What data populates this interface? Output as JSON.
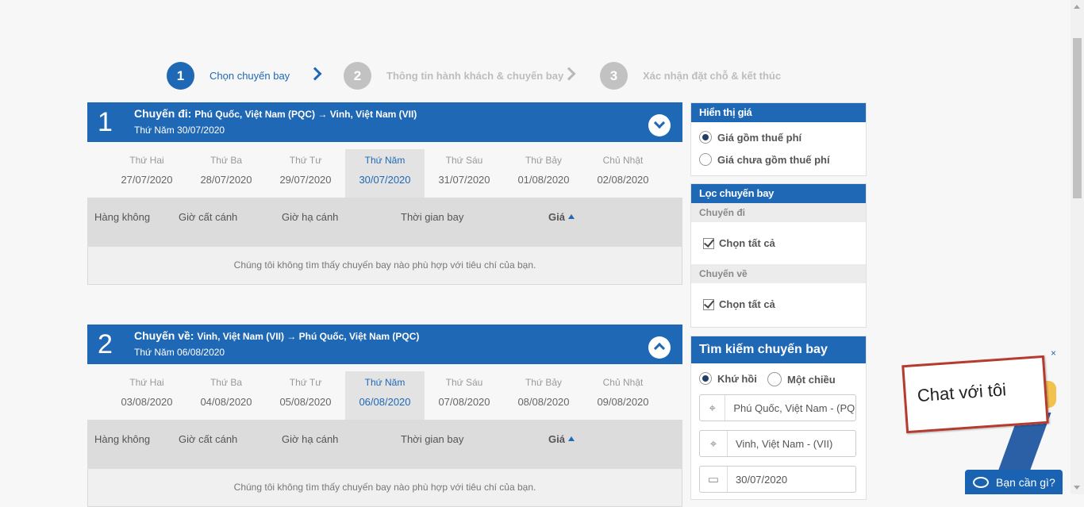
{
  "steps": [
    {
      "num": "1",
      "label": "Chọn chuyến bay"
    },
    {
      "num": "2",
      "label": "Thông tin hành khách & chuyến bay"
    },
    {
      "num": "3",
      "label": "Xác nhận đặt chỗ & kết thúc"
    }
  ],
  "outbound": {
    "index": "1",
    "title_prefix": "Chuyến đi:",
    "route": "Phú Quốc, Việt Nam (PQC) → Vinh, Việt Nam (VII)",
    "date": "Thứ Năm 30/07/2020",
    "days": [
      {
        "name": "Thứ Hai",
        "date": "27/07/2020"
      },
      {
        "name": "Thứ Ba",
        "date": "28/07/2020"
      },
      {
        "name": "Thứ Tư",
        "date": "29/07/2020"
      },
      {
        "name": "Thứ Năm",
        "date": "30/07/2020"
      },
      {
        "name": "Thứ Sáu",
        "date": "31/07/2020"
      },
      {
        "name": "Thứ Bảy",
        "date": "01/08/2020"
      },
      {
        "name": "Chủ Nhật",
        "date": "02/08/2020"
      }
    ],
    "selected_day": 3
  },
  "inbound": {
    "index": "2",
    "title_prefix": "Chuyến về:",
    "route": "Vinh, Việt Nam (VII) → Phú Quốc, Việt Nam (PQC)",
    "date": "Thứ Năm 06/08/2020",
    "days": [
      {
        "name": "Thứ Hai",
        "date": "03/08/2020"
      },
      {
        "name": "Thứ Ba",
        "date": "04/08/2020"
      },
      {
        "name": "Thứ Tư",
        "date": "05/08/2020"
      },
      {
        "name": "Thứ Năm",
        "date": "06/08/2020"
      },
      {
        "name": "Thứ Sáu",
        "date": "07/08/2020"
      },
      {
        "name": "Thứ Bảy",
        "date": "08/08/2020"
      },
      {
        "name": "Chủ Nhật",
        "date": "09/08/2020"
      }
    ],
    "selected_day": 3
  },
  "columns": {
    "airline": "Hàng không",
    "depart": "Giờ cất cánh",
    "arrive": "Giờ hạ cánh",
    "duration": "Thời gian bay",
    "price": "Giá"
  },
  "no_results": "Chúng tôi không tìm thấy chuyến bay nào phù hợp với tiêu chí của bạn.",
  "price_display": {
    "title": "Hiển thị giá",
    "opt_incl": "Giá gồm thuế phí",
    "opt_excl": "Giá chưa gồm thuế phí",
    "selected": "opt_incl"
  },
  "filter": {
    "title": "Lọc chuyến bay",
    "outbound_label": "Chuyến đi",
    "inbound_label": "Chuyến về",
    "select_all": "Chọn tất cả"
  },
  "search": {
    "title": "Tìm kiếm chuyến bay",
    "round_trip": "Khứ hồi",
    "one_way": "Một chiều",
    "from": "Phú Quốc, Việt Nam - (PQC)",
    "to": "Vinh, Việt Nam - (VII)",
    "depart_date": "30/07/2020"
  },
  "chat": {
    "sign": "Chat với tôi",
    "close": "×",
    "button": "Bạn cần gì?"
  },
  "colors": {
    "primary": "#1f68b6",
    "inactive": "#c2c2c2"
  }
}
